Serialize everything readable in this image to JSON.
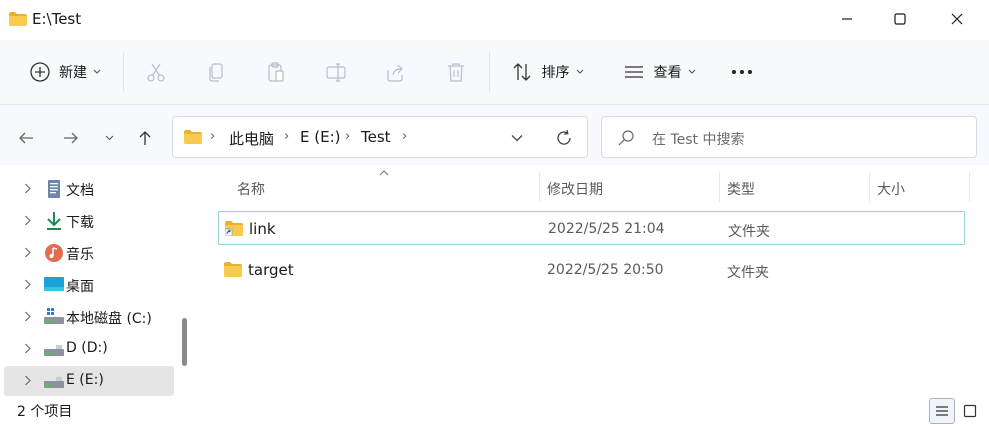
{
  "window": {
    "title": "E:\\Test",
    "controls": {
      "minimize": "minimize-icon",
      "maximize": "maximize-icon",
      "close": "close-icon"
    }
  },
  "commandbar": {
    "new_label": "新建",
    "sort_label": "排序",
    "view_label": "查看",
    "more_label": "•••",
    "icons": [
      "plus-icon",
      "cut-icon",
      "copy-icon",
      "paste-icon",
      "rename-icon",
      "share-icon",
      "delete-icon",
      "sort-icon",
      "view-icon",
      "more-icon"
    ]
  },
  "address": {
    "crumbs": [
      "此电脑",
      "E (E:)",
      "Test"
    ],
    "sep": "›"
  },
  "search": {
    "placeholder": "在 Test 中搜索"
  },
  "sidebar": {
    "items": [
      {
        "label": "文档",
        "icon": "documents-icon"
      },
      {
        "label": "下载",
        "icon": "downloads-icon"
      },
      {
        "label": "音乐",
        "icon": "music-icon"
      },
      {
        "label": "桌面",
        "icon": "desktop-icon"
      },
      {
        "label": "本地磁盘 (C:)",
        "icon": "drive-icon"
      },
      {
        "label": "D (D:)",
        "icon": "drive-icon"
      },
      {
        "label": "E (E:)",
        "icon": "drive-icon",
        "selected": true
      }
    ]
  },
  "columns": {
    "name": "名称",
    "modified": "修改日期",
    "type": "类型",
    "size": "大小"
  },
  "files": [
    {
      "name": "link",
      "modified": "2022/5/25 21:04",
      "type": "文件夹",
      "icon": "folder-shortcut-icon",
      "selected": true
    },
    {
      "name": "target",
      "modified": "2022/5/25 20:50",
      "type": "文件夹",
      "icon": "folder-icon"
    }
  ],
  "status": {
    "count": "2 个项目"
  },
  "colors": {
    "accent": "#0067c0",
    "folder": "#f6c342",
    "selection_border": "#99d1e1"
  }
}
